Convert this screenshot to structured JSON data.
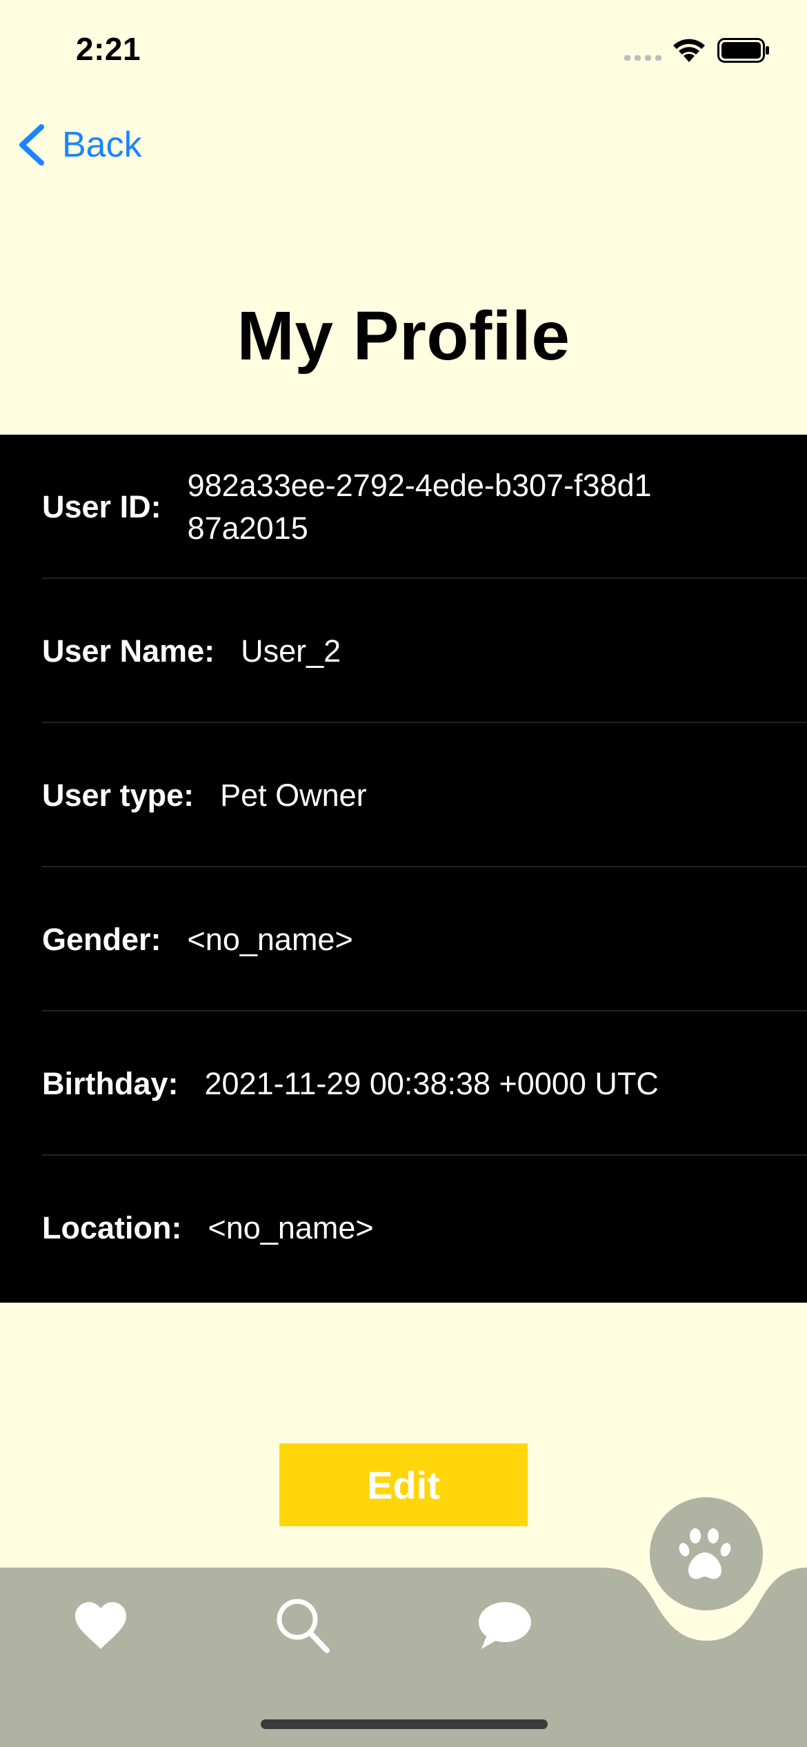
{
  "status_bar": {
    "time": "2:21",
    "icons": [
      "signal-icon",
      "wifi-icon",
      "battery-icon"
    ]
  },
  "nav": {
    "back_label": "Back",
    "back_icon": "chevron-left-icon"
  },
  "page_title": "My Profile",
  "profile": {
    "fields": [
      {
        "label": "User ID:",
        "value": "982a33ee-2792-4ede-b307-f38d187a2015"
      },
      {
        "label": "User Name:",
        "value": "User_2"
      },
      {
        "label": "User type:",
        "value": "Pet Owner"
      },
      {
        "label": "Gender:",
        "value": "<no_name>"
      },
      {
        "label": "Birthday:",
        "value": "2021-11-29 00:38:38 +0000 UTC"
      },
      {
        "label": "Location:",
        "value": "<no_name>"
      }
    ]
  },
  "edit_button": {
    "label": "Edit"
  },
  "tab_bar": {
    "tabs": [
      "heart-icon",
      "search-icon",
      "chat-icon",
      "paw-icon"
    ],
    "selected": "paw-icon"
  },
  "colors": {
    "background": "#FFFEE0",
    "panel": "#000000",
    "accent_link": "#1A84FF",
    "edit_button": "#FFD60A",
    "tab_bar": "#B0B2A2"
  }
}
